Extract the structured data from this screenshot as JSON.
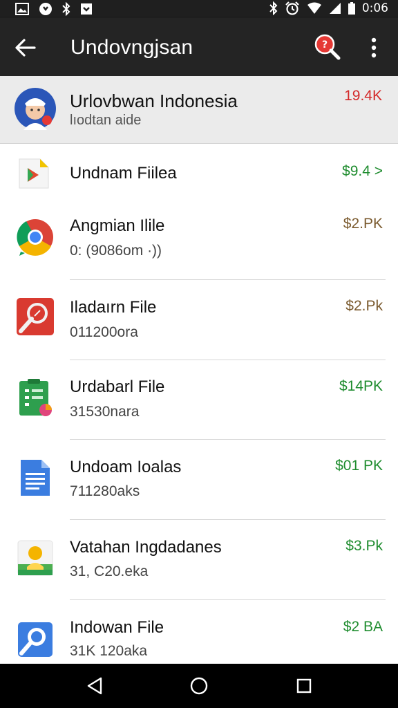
{
  "status_bar": {
    "time": "0:06",
    "icons": [
      "gallery-icon",
      "record-icon",
      "bluetooth-icon",
      "download-icon",
      "bluetooth-icon",
      "alarm-icon",
      "wifi-icon",
      "signal-icon",
      "battery-icon"
    ]
  },
  "app_bar": {
    "title": "Undovngjsan",
    "icons": [
      "back-arrow-icon",
      "search-icon",
      "more-vert-icon"
    ]
  },
  "account": {
    "name": "Urlovbwan Indonesia",
    "subtitle": "lıodtan aide",
    "count": "19.4K",
    "count_color": "#d42828"
  },
  "files": [
    {
      "name": "Undnam Fiilea",
      "detail": "",
      "size": "$9.4 >",
      "size_color": "#1e8c2e",
      "icon": "play-store-icon"
    },
    {
      "name": "Angmian Ilile",
      "detail": "0: (9086om ·))",
      "size": "$2.PK",
      "size_color": "#7a5a2e",
      "icon": "chrome-icon"
    },
    {
      "name": "Iladaırn File",
      "detail": "011200ora",
      "size": "$2.Pk",
      "size_color": "#7a5a2e",
      "icon": "magnifier-red-icon"
    },
    {
      "name": "Urdabarl File",
      "detail": "31530nara",
      "size": "$14PK",
      "size_color": "#1e8c2e",
      "icon": "sheet-icon"
    },
    {
      "name": "Undoam Ioalas",
      "detail": "711280aks",
      "size": "$01 PK",
      "size_color": "#1e8c2e",
      "icon": "doc-icon"
    },
    {
      "name": "Vatahan Ingdadanes",
      "detail": "31, C20.eka",
      "size": "$3.Pk",
      "size_color": "#1e8c2e",
      "icon": "contact-icon"
    },
    {
      "name": "Indowan File",
      "detail": "31K 120aka",
      "size": "$2 BA",
      "size_color": "#1e8c2e",
      "icon": "search-file-icon"
    }
  ],
  "nav_bar": {
    "icons": [
      "back-triangle-icon",
      "home-circle-icon",
      "recents-square-icon"
    ]
  }
}
